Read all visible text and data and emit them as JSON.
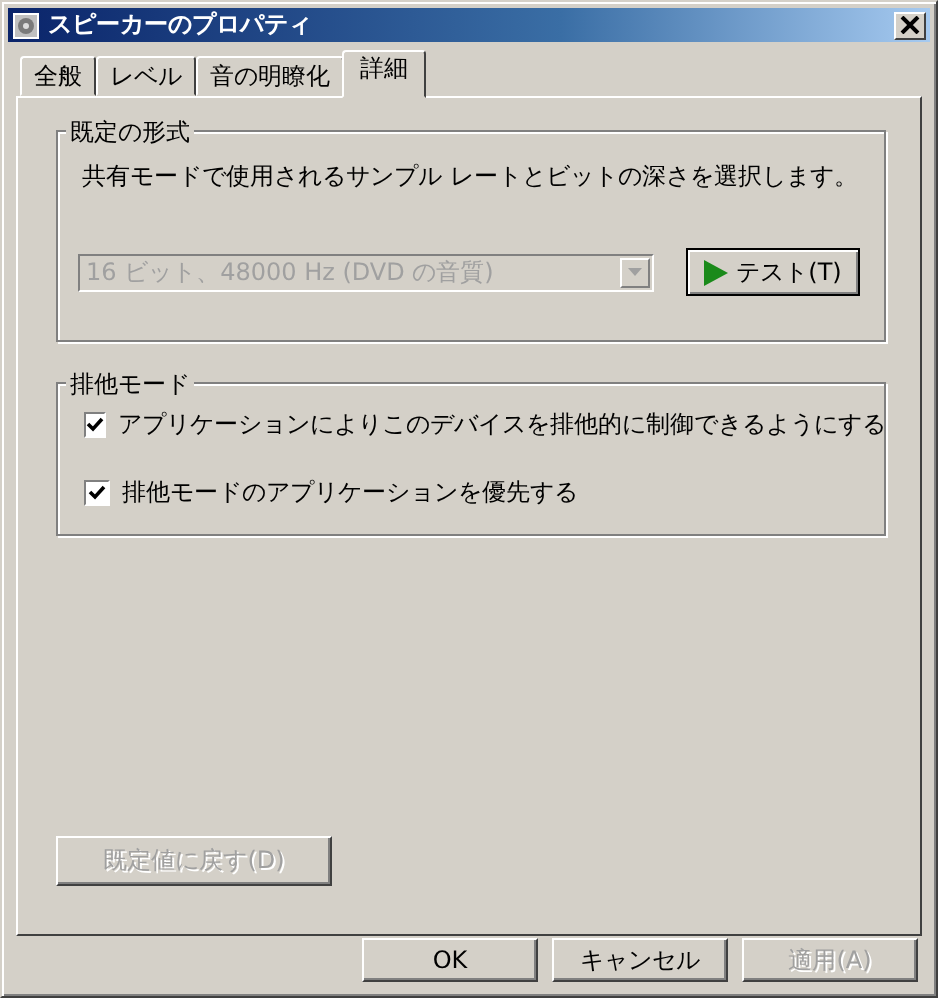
{
  "window": {
    "title": "スピーカーのプロパティ"
  },
  "tabs": [
    {
      "label": "全般",
      "selected": false
    },
    {
      "label": "レベル",
      "selected": false
    },
    {
      "label": "音の明瞭化",
      "selected": false
    },
    {
      "label": "詳細",
      "selected": true
    }
  ],
  "default_format": {
    "title": "既定の形式",
    "description": "共有モードで使用されるサンプル レートとビットの深さを選択します。",
    "dropdown": {
      "value": "16 ビット、48000 Hz (DVD の音質)",
      "disabled": true
    },
    "test_button": {
      "label": "テスト(T)",
      "disabled": false
    }
  },
  "exclusive_mode": {
    "title": "排他モード",
    "options": [
      {
        "label": "アプリケーションによりこのデバイスを排他的に制御できるようにする",
        "checked": true
      },
      {
        "label": "排他モードのアプリケーションを優先する",
        "checked": true
      }
    ]
  },
  "restore_button": {
    "label": "既定値に戻す(D)",
    "disabled": true
  },
  "buttons": [
    {
      "label": "OK",
      "disabled": false
    },
    {
      "label": "キャンセル",
      "disabled": false
    },
    {
      "label": "適用(A)",
      "disabled": true
    }
  ]
}
